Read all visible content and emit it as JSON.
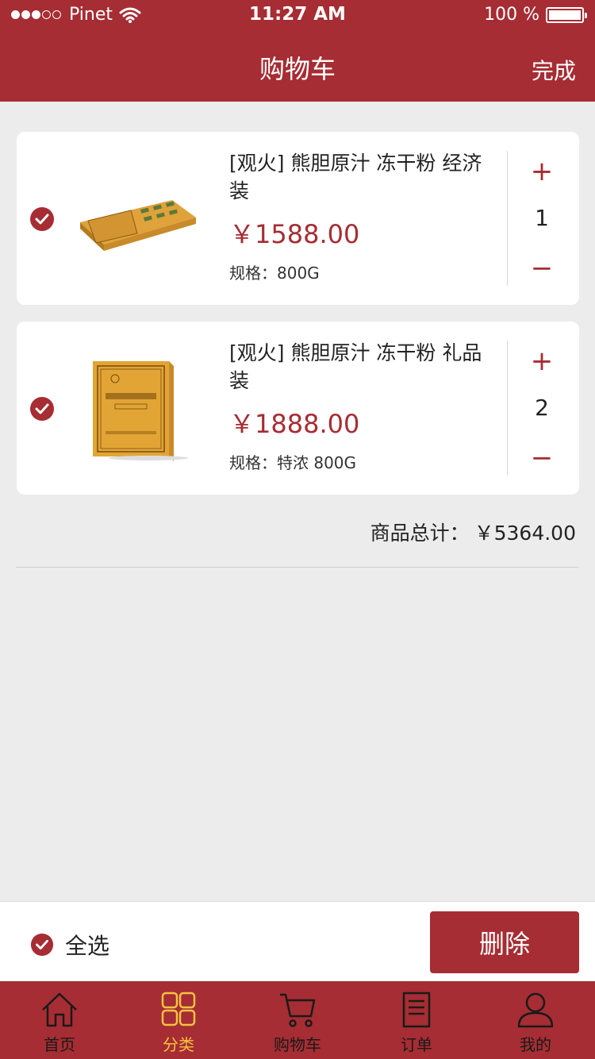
{
  "status_bar": {
    "carrier": "Pinet",
    "time": "11:27 AM",
    "battery": "100 %"
  },
  "nav": {
    "title": "购物车",
    "action": "完成"
  },
  "cart_items": [
    {
      "name": "[观火] 熊胆原汁 冻干粉 经济装",
      "price": "￥1588.00",
      "spec": "规格：800G",
      "quantity": "1",
      "plus": "+",
      "minus": "−",
      "checked": true
    },
    {
      "name": "[观火] 熊胆原汁 冻干粉 礼品装",
      "price": "￥1888.00",
      "spec": "规格：特浓 800G",
      "quantity": "2",
      "plus": "+",
      "minus": "−",
      "checked": true
    }
  ],
  "summary": {
    "label": "商品总计：",
    "amount": "￥5364.00"
  },
  "actions": {
    "select_all": "全选",
    "delete": "删除"
  },
  "tabs": [
    {
      "label": "首页",
      "icon": "home-icon",
      "active": false
    },
    {
      "label": "分类",
      "icon": "grid-icon",
      "active": true
    },
    {
      "label": "购物车",
      "icon": "cart-icon",
      "active": false
    },
    {
      "label": "订单",
      "icon": "order-icon",
      "active": false
    },
    {
      "label": "我的",
      "icon": "user-icon",
      "active": false
    }
  ],
  "colors": {
    "brand": "#a62d33",
    "active_tab": "#f5c242",
    "background": "#ececec"
  }
}
